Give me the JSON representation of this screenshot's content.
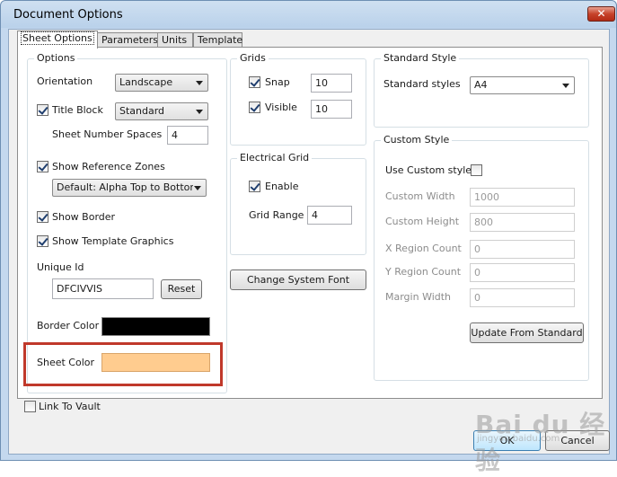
{
  "window": {
    "title": "Document Options",
    "close_glyph": "✕"
  },
  "tabs": [
    {
      "label": "Sheet Options",
      "active": true
    },
    {
      "label": "Parameters"
    },
    {
      "label": "Units"
    },
    {
      "label": "Template"
    }
  ],
  "options": {
    "legend": "Options",
    "orientation_label": "Orientation",
    "orientation_value": "Landscape",
    "title_block_label": "Title Block",
    "title_block_checked": true,
    "title_block_value": "Standard",
    "sheet_number_spaces_label": "Sheet Number Spaces",
    "sheet_number_spaces_value": "4",
    "show_reference_zones_label": "Show Reference Zones",
    "show_reference_zones_checked": true,
    "reference_zones_value": "Default: Alpha Top to Bottom",
    "show_border_label": "Show Border",
    "show_border_checked": true,
    "show_template_graphics_label": "Show Template Graphics",
    "show_template_graphics_checked": true,
    "unique_id_label": "Unique Id",
    "unique_id_value": "DFCIVVIS",
    "reset_label": "Reset",
    "border_color_label": "Border Color",
    "border_color": "#000000",
    "sheet_color_label": "Sheet Color",
    "sheet_color": "#ffcc8f"
  },
  "grids": {
    "legend": "Grids",
    "snap_label": "Snap",
    "snap_checked": true,
    "snap_value": "10",
    "visible_label": "Visible",
    "visible_checked": true,
    "visible_value": "10"
  },
  "electrical_grid": {
    "legend": "Electrical Grid",
    "enable_label": "Enable",
    "enable_checked": true,
    "grid_range_label": "Grid Range",
    "grid_range_value": "4"
  },
  "change_system_font_label": "Change System Font",
  "standard_style": {
    "legend": "Standard Style",
    "standard_styles_label": "Standard styles",
    "standard_styles_value": "A4"
  },
  "custom_style": {
    "legend": "Custom Style",
    "use_custom_style_label": "Use Custom style",
    "use_custom_style_checked": false,
    "custom_width_label": "Custom Width",
    "custom_width_value": "1000",
    "custom_height_label": "Custom Height",
    "custom_height_value": "800",
    "x_region_count_label": "X Region Count",
    "x_region_count_value": "0",
    "y_region_count_label": "Y Region Count",
    "y_region_count_value": "0",
    "margin_width_label": "Margin Width",
    "margin_width_value": "0",
    "update_from_standard_label": "Update From Standard"
  },
  "link_to_vault_label": "Link To Vault",
  "link_to_vault_checked": false,
  "ok_label": "OK",
  "cancel_label": "Cancel",
  "highlight_color": "#c0392b",
  "watermark": {
    "text": "Bai du 经验",
    "sub": "jingyan.baidu.com"
  }
}
